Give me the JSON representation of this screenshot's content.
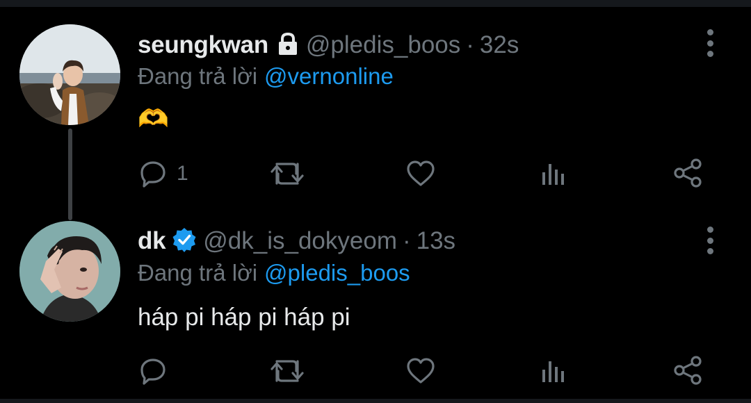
{
  "colors": {
    "background": "#000000",
    "primary_text": "#e7e9ea",
    "secondary_text": "#6e767d",
    "accent": "#1d9bf0"
  },
  "tweets": [
    {
      "name": "seungkwan",
      "badge_icon": "lock-icon",
      "handle": "@pledis_boos",
      "time_sep": "·",
      "time": "32s",
      "reply_prefix": "Đang trả lời",
      "reply_to": "@vernonline",
      "text": "🫶",
      "reply_count": "1",
      "actions": [
        "reply-icon",
        "retweet-icon",
        "like-icon",
        "analytics-icon",
        "share-icon"
      ]
    },
    {
      "name": "dk",
      "badge_icon": "verified-badge-icon",
      "handle": "@dk_is_dokyeom",
      "time_sep": "·",
      "time": "13s",
      "reply_prefix": "Đang trả lời",
      "reply_to": "@pledis_boos",
      "text": "háp pi háp pi háp pi",
      "reply_count": "",
      "actions": [
        "reply-icon",
        "retweet-icon",
        "like-icon",
        "analytics-icon",
        "share-icon"
      ]
    }
  ]
}
